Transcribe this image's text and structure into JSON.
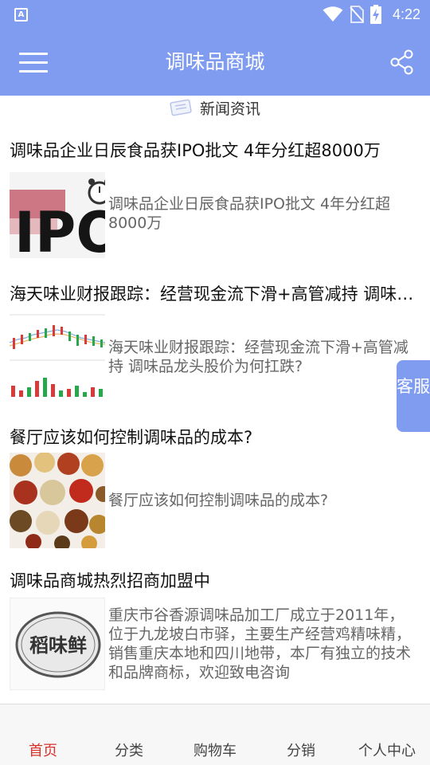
{
  "status_bar": {
    "app_icon_letter": "A",
    "time": "4:22",
    "icons": [
      "wifi-icon",
      "no-sim-icon",
      "battery-charging-icon"
    ]
  },
  "app_bar": {
    "title": "调味品商城",
    "menu_icon": "hamburger-menu-icon",
    "share_icon": "share-icon"
  },
  "section": {
    "icon": "news-icon",
    "title": "新闻资讯"
  },
  "news": [
    {
      "title": "调味品企业日辰食品获IPO批文 4年分红超8000万",
      "summary": "调味品企业日辰食品获IPO批文 4年分红超8000万",
      "thumb": "ipo-image"
    },
    {
      "title": "海天味业财报跟踪：经营现金流下滑+高管减持 调味品龙头股价为何扛跌？",
      "summary": "海天味业财报跟踪：经营现金流下滑+高管减持 调味品龙头股价为何扛跌?",
      "thumb": "stock-chart-image"
    },
    {
      "title": "餐厅应该如何控制调味品的成本?",
      "summary": "餐厅应该如何控制调味品的成本?",
      "thumb": "spices-image"
    },
    {
      "title": "调味品商城热烈招商加盟中",
      "summary": "重庆市谷香源调味品加工厂成立于2011年，位于九龙坡白市驿，主要生产经营鸡精味精，销售重庆本地和四川地带，本厂有独立的技术和品牌商标，欢迎致电咨询",
      "thumb": "brand-stamp-image",
      "stamp_text": "稻味鲜"
    }
  ],
  "support_tab": {
    "label": "客服"
  },
  "bottom_nav": [
    {
      "label": "首页",
      "active": true
    },
    {
      "label": "分类",
      "active": false
    },
    {
      "label": "购物车",
      "active": false
    },
    {
      "label": "分销",
      "active": false
    },
    {
      "label": "个人中心",
      "active": false
    }
  ],
  "colors": {
    "primary": "#7f9cf0",
    "active_nav": "#d9302a",
    "summary_text": "#666666"
  }
}
